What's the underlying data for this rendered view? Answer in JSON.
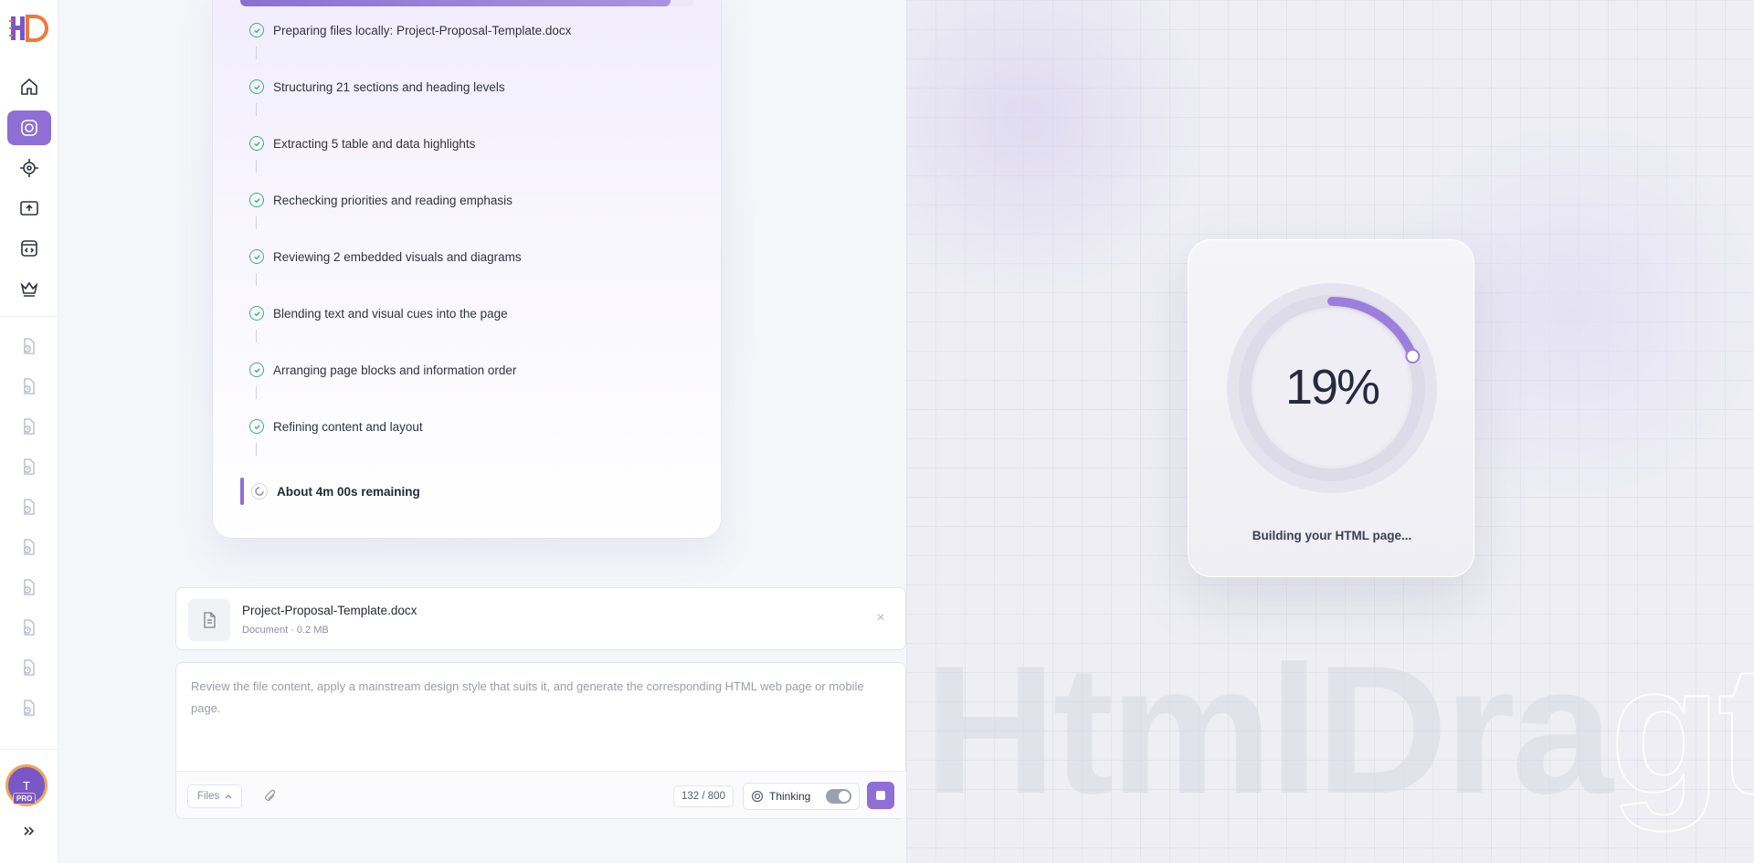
{
  "app": {
    "logo_text": "HD",
    "accent_color": "#8f6ed5",
    "success_color": "#38b27a"
  },
  "sidebar": {
    "nav": [
      {
        "name": "home",
        "icon": "home-icon"
      },
      {
        "name": "create",
        "icon": "camera-icon",
        "active": true
      },
      {
        "name": "target",
        "icon": "crosshair-icon"
      },
      {
        "name": "upload",
        "icon": "upload-icon"
      },
      {
        "name": "code",
        "icon": "code-window-icon"
      },
      {
        "name": "premium",
        "icon": "crown-icon"
      }
    ],
    "history_count": 10,
    "avatar_initial": "T",
    "plan_badge": "PRO"
  },
  "progress_steps": {
    "top_bar_progress": 0.95,
    "steps": [
      {
        "label": "Preparing files locally: Project-Proposal-Template.docx",
        "status": "done"
      },
      {
        "label": "Structuring 21 sections and heading levels",
        "status": "done"
      },
      {
        "label": "Extracting 5 table and data highlights",
        "status": "done"
      },
      {
        "label": "Rechecking priorities and reading emphasis",
        "status": "done"
      },
      {
        "label": "Reviewing 2 embedded visuals and diagrams",
        "status": "done"
      },
      {
        "label": "Blending text and visual cues into the page",
        "status": "done"
      },
      {
        "label": "Arranging page blocks and information order",
        "status": "done"
      },
      {
        "label": "Refining content and layout",
        "status": "done"
      }
    ],
    "current": "About 4m 00s remaining"
  },
  "file": {
    "name": "Project-Proposal-Template.docx",
    "meta": "Document · 0.2 MB",
    "close": "×"
  },
  "prompt": {
    "text": "Review the file content, apply a mainstream design style that suits it, and generate the corresponding HTML web page or mobile page.",
    "files_label": "Files",
    "counter": "132 / 800",
    "thinking_label": "Thinking",
    "thinking_enabled": true
  },
  "preview": {
    "progress_percent": 19,
    "progress_text": "19%",
    "caption": "Building your HTML page...",
    "watermark_solid": "HtmlDra",
    "watermark_outline": "gt"
  }
}
